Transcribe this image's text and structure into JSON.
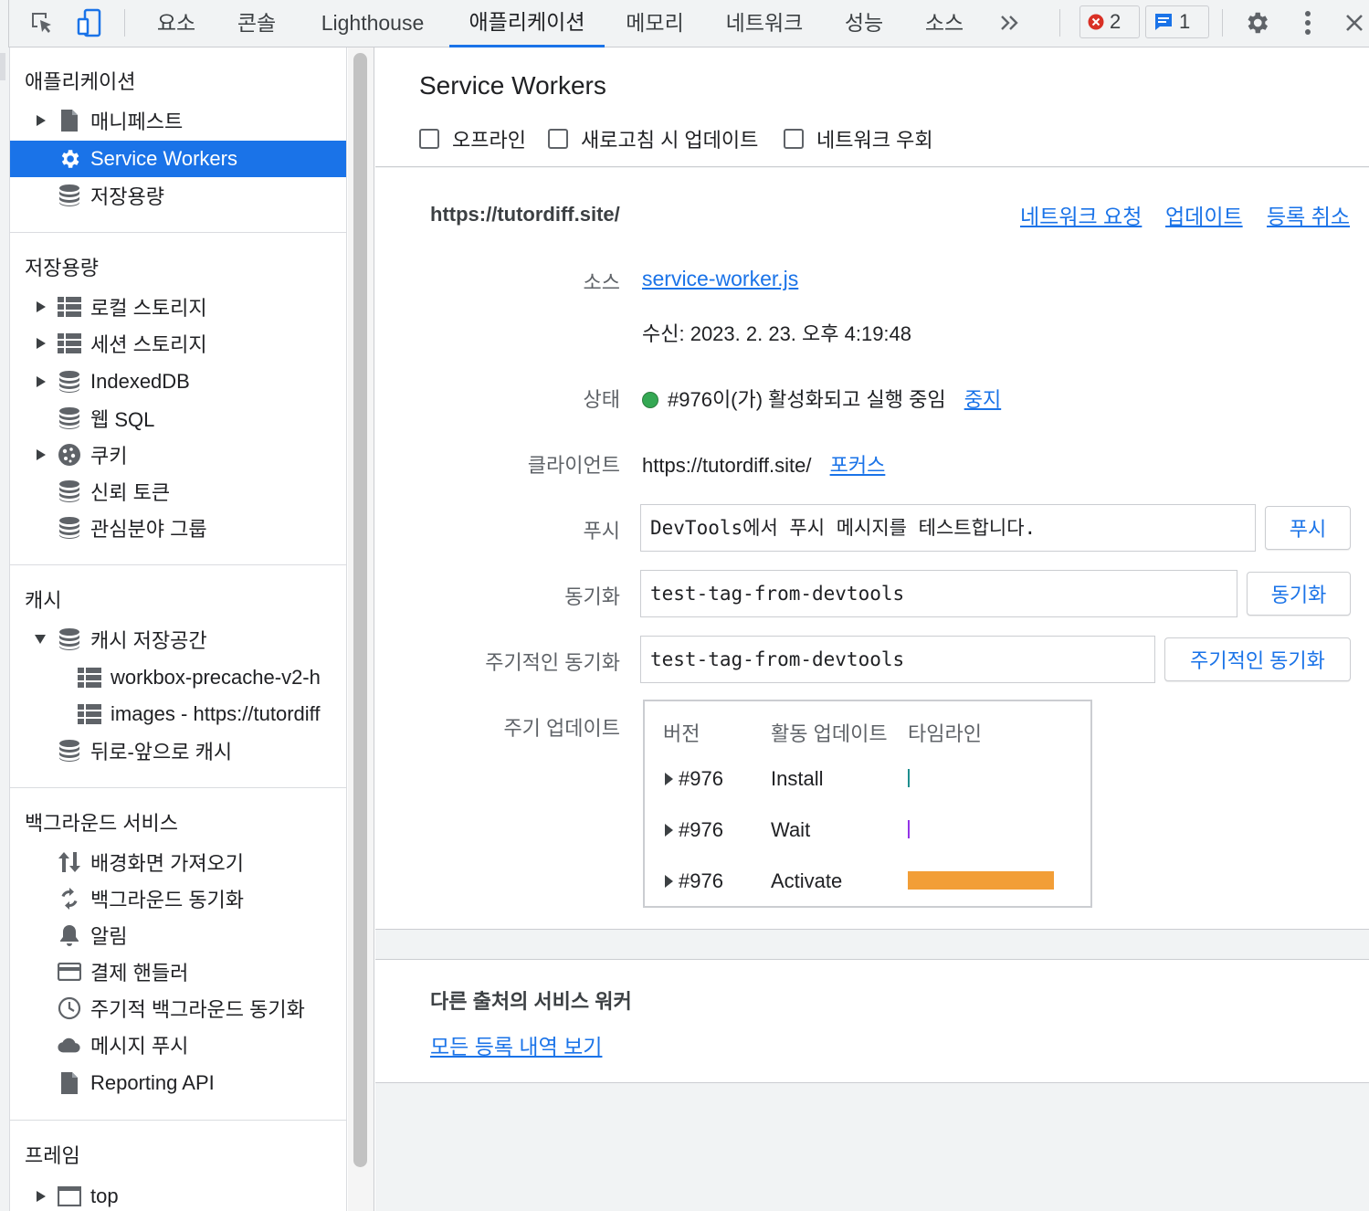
{
  "toolbar": {
    "tabs": [
      {
        "label": "요소"
      },
      {
        "label": "콘솔"
      },
      {
        "label": "Lighthouse"
      },
      {
        "label": "애플리케이션"
      },
      {
        "label": "메모리"
      },
      {
        "label": "네트워크"
      },
      {
        "label": "성능"
      },
      {
        "label": "소스"
      }
    ],
    "more_icon": "double-chevron-right-icon",
    "error_count": "2",
    "message_count": "1"
  },
  "sidebar": {
    "sections": [
      {
        "header": "애플리케이션",
        "items": [
          {
            "label": "매니페스트",
            "icon": "document-icon"
          },
          {
            "label": "Service Workers",
            "icon": "gear-icon"
          },
          {
            "label": "저장용량",
            "icon": "database-icon"
          }
        ]
      },
      {
        "header": "저장용량",
        "items": [
          {
            "label": "로컬 스토리지",
            "icon": "table-icon"
          },
          {
            "label": "세션 스토리지",
            "icon": "table-icon"
          },
          {
            "label": "IndexedDB",
            "icon": "database-icon"
          },
          {
            "label": "웹 SQL",
            "icon": "database-icon"
          },
          {
            "label": "쿠키",
            "icon": "cookie-icon"
          },
          {
            "label": "신뢰 토큰",
            "icon": "database-icon"
          },
          {
            "label": "관심분야 그룹",
            "icon": "database-icon"
          }
        ]
      },
      {
        "header": "캐시",
        "items": [
          {
            "label": "캐시 저장공간",
            "icon": "database-icon"
          },
          {
            "label": "workbox-precache-v2-h",
            "icon": "table-icon"
          },
          {
            "label": "images - https://tutordiff",
            "icon": "table-icon"
          },
          {
            "label": "뒤로-앞으로 캐시",
            "icon": "database-icon"
          }
        ]
      },
      {
        "header": "백그라운드 서비스",
        "items": [
          {
            "label": "배경화면 가져오기",
            "icon": "up-down-arrows-icon"
          },
          {
            "label": "백그라운드 동기화",
            "icon": "sync-icon"
          },
          {
            "label": "알림",
            "icon": "bell-icon"
          },
          {
            "label": "결제 핸들러",
            "icon": "credit-card-icon"
          },
          {
            "label": "주기적 백그라운드 동기화",
            "icon": "clock-icon"
          },
          {
            "label": "메시지 푸시",
            "icon": "cloud-icon"
          },
          {
            "label": "Reporting API",
            "icon": "document-icon"
          }
        ]
      },
      {
        "header": "프레임",
        "items": [
          {
            "label": "top",
            "icon": "frame-icon"
          }
        ]
      }
    ]
  },
  "main": {
    "title": "Service Workers",
    "options": [
      {
        "label": "오프라인",
        "checked": false
      },
      {
        "label": "새로고침 시 업데이트",
        "checked": false
      },
      {
        "label": "네트워크 우회",
        "checked": false
      }
    ],
    "worker": {
      "origin": "https://tutordiff.site/",
      "actions": [
        "네트워크 요청",
        "업데이트",
        "등록 취소"
      ],
      "source_label": "소스",
      "source_link": "service-worker.js",
      "received": "수신: 2023. 2. 23. 오후 4:19:48",
      "status_label": "상태",
      "status_text": "#976이(가) 활성화되고 실행 중임",
      "status_action": "중지",
      "status_color": "#34a853",
      "client_label": "클라이언트",
      "client_url": "https://tutordiff.site/",
      "client_action": "포커스",
      "push_label": "푸시",
      "push_value": "DevTools에서 푸시 메시지를 테스트합니다.",
      "push_button": "푸시",
      "sync_label": "동기화",
      "sync_value": "test-tag-from-devtools",
      "sync_button": "동기화",
      "periodic_label": "주기적인 동기화",
      "periodic_value": "test-tag-from-devtools",
      "periodic_button": "주기적인 동기화",
      "update_cycle_label": "주기 업데이트",
      "update_cycle": {
        "headers": [
          "버전",
          "활동 업데이트",
          "타임라인"
        ],
        "rows": [
          {
            "version": "#976",
            "event": "Install",
            "color": "#1e8e8e"
          },
          {
            "version": "#976",
            "event": "Wait",
            "color": "#9334e6"
          },
          {
            "version": "#976",
            "event": "Activate",
            "color": "#f29e37"
          }
        ]
      }
    },
    "other_origins": {
      "title": "다른 출처의 서비스 워커",
      "link": "모든 등록 내역 보기"
    }
  }
}
